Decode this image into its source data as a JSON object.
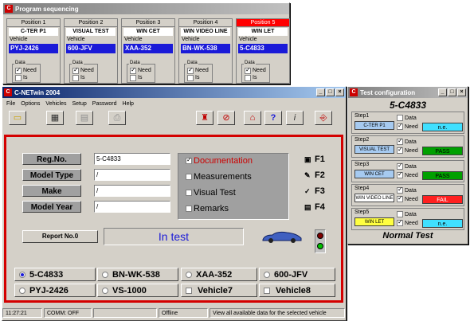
{
  "seq_window": {
    "title": "Program sequencing",
    "positions": [
      {
        "head": "Position 1",
        "test": "C-TER P1",
        "vehicle_label": "Vehicle",
        "vehicle": "PYJ-2426",
        "data_label": "Data",
        "need": "Need",
        "is": "Is",
        "need_checked": true,
        "active": false
      },
      {
        "head": "Position 2",
        "test": "VISUAL TEST",
        "vehicle_label": "Vehicle",
        "vehicle": "600-JFV",
        "data_label": "Data",
        "need": "Need",
        "is": "Is",
        "need_checked": true,
        "active": false
      },
      {
        "head": "Position 3",
        "test": "WIN CET",
        "vehicle_label": "Vehicle",
        "vehicle": "XAA-352",
        "data_label": "Data",
        "need": "Need",
        "is": "Is",
        "need_checked": true,
        "active": false
      },
      {
        "head": "Position 4",
        "test": "WIN VIDEO LINE",
        "vehicle_label": "Vehicle",
        "vehicle": "BN-WK-538",
        "data_label": "Data",
        "need": "Need",
        "is": "Is",
        "need_checked": true,
        "active": false
      },
      {
        "head": "Position 5",
        "test": "WIN LET",
        "vehicle_label": "Vehicle",
        "vehicle": "5-C4833",
        "data_label": "Data",
        "need": "Need",
        "is": "Is",
        "need_checked": true,
        "active": true
      }
    ]
  },
  "main_window": {
    "title": "C-NETwin 2004",
    "menu": [
      "File",
      "Options",
      "Vehicles",
      "Setup",
      "Password",
      "Help"
    ],
    "fields": [
      {
        "label": "Reg.No.",
        "value": "5-C4833"
      },
      {
        "label": "Model Type",
        "value": "/"
      },
      {
        "label": "Make",
        "value": "/"
      },
      {
        "label": "Model Year",
        "value": "/"
      }
    ],
    "options": [
      {
        "label": "Documentation",
        "checked": true,
        "color": "#cc0000"
      },
      {
        "label": "Measurements",
        "checked": false,
        "color": "#000000"
      },
      {
        "label": "Visual Test",
        "checked": false,
        "color": "#000000"
      },
      {
        "label": "Remarks",
        "checked": false,
        "color": "#000000"
      }
    ],
    "fkeys": [
      "F1",
      "F2",
      "F3",
      "F4"
    ],
    "report_label": "Report No.0",
    "status_text": "In test",
    "vehicles": [
      {
        "label": "5-C4833",
        "type": "radio",
        "on": true
      },
      {
        "label": "BN-WK-538",
        "type": "radio",
        "on": false
      },
      {
        "label": "XAA-352",
        "type": "radio",
        "on": false
      },
      {
        "label": "600-JFV",
        "type": "radio",
        "on": false
      },
      {
        "label": "PYJ-2426",
        "type": "radio",
        "on": false
      },
      {
        "label": "VS-1000",
        "type": "radio",
        "on": false
      },
      {
        "label": "Vehicle7",
        "type": "check",
        "on": false
      },
      {
        "label": "Vehicle8",
        "type": "check",
        "on": false
      }
    ],
    "statusbar": {
      "time": "11:27:21",
      "comm": "COMM: OFF",
      "mode": "Offline",
      "message": "View all available data for the selected vehicle"
    }
  },
  "config_window": {
    "title": "Test configuration",
    "vehicle": "5-C4833",
    "footer": "Normal Test",
    "steps": [
      {
        "label": "Step1",
        "name": "C-TER P1",
        "name_bg": "#a6caf0",
        "data": false,
        "need": true,
        "data_label": "Data",
        "need_label": "Need",
        "result": "n.e.",
        "result_bg": "#40e0ff",
        "result_color": "#000"
      },
      {
        "label": "Step2",
        "name": "VISUAL TEST",
        "name_bg": "#a6caf0",
        "data": true,
        "need": true,
        "data_label": "Data",
        "need_label": "Need",
        "result": "PASS",
        "result_bg": "#00a000",
        "result_color": "#000"
      },
      {
        "label": "Step3",
        "name": "WIN CET",
        "name_bg": "#a6caf0",
        "data": true,
        "need": true,
        "data_label": "Data",
        "need_label": "Need",
        "result": "PASS",
        "result_bg": "#00a000",
        "result_color": "#000"
      },
      {
        "label": "Step4",
        "name": "WIN VIDEO LINE",
        "name_bg": "#ffffff",
        "data": true,
        "need": true,
        "data_label": "Data",
        "need_label": "Need",
        "result": "FAIL",
        "result_bg": "#ff2020",
        "result_color": "#fff"
      },
      {
        "label": "Step5",
        "name": "WIN LET",
        "name_bg": "#ffff40",
        "data": false,
        "need": true,
        "data_label": "Data",
        "need_label": "Need",
        "result": "n.e.",
        "result_bg": "#40e0ff",
        "result_color": "#000"
      }
    ]
  }
}
